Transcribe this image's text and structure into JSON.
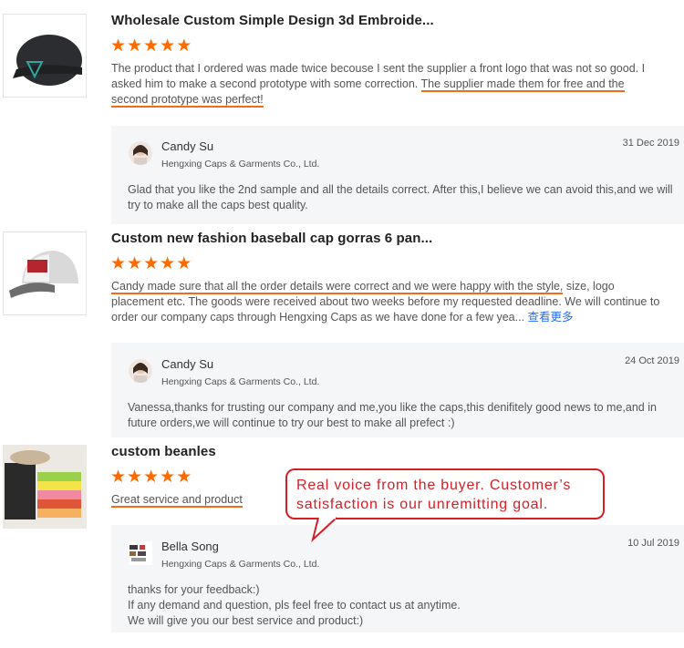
{
  "reviews": [
    {
      "title": "Wholesale Custom Simple Design 3d Embroide...",
      "stars": 5,
      "text_plain": "The product that I ordered was made twice becouse I sent the supplier a front logo that was not so good. I asked him to make a second prototype with some correction. ",
      "text_highlight": "The supplier made them for free and the second prototype was perfect!",
      "reply": {
        "name": "Candy Su",
        "company": "Hengxing Caps & Garments Co., Ltd.",
        "date": "31 Dec 2019",
        "text": "Glad that you like the 2nd sample and all the details correct. After this,I believe we can avoid this,and we will try to make all the caps best quality."
      }
    },
    {
      "title": "Custom new fashion baseball cap gorras 6 pan...",
      "stars": 5,
      "text_highlight": "Candy made sure that all the order details were correct and we were happy with the style,",
      "text_plain": " size, logo placement etc. The goods were received about two weeks before my requested deadline. We will continue to order our company caps through Hengxing Caps as we have done for a few yea...",
      "more_link": "查看更多",
      "reply": {
        "name": "Candy Su",
        "company": "Hengxing Caps & Garments Co., Ltd.",
        "date": "24 Oct 2019",
        "text": "Vanessa,thanks for trusting our company and me,you like the caps,this denifitely good news to me,and in future orders,we will continue to try our best to make all prefect :)"
      }
    },
    {
      "title": "custom beanles",
      "stars": 5,
      "text_highlight": "Great service and product",
      "reply": {
        "name": "Bella Song",
        "company": "Hengxing Caps & Garments Co., Ltd.",
        "date": "10 Jul 2019",
        "text_lines": [
          "thanks for your feedback:)",
          "If any demand and question, pls feel free to contact us at anytime.",
          "We will give you our best service and product:)"
        ]
      }
    }
  ],
  "callout": {
    "text": "Real voice from the buyer. Customer’s satisfaction is our unremitting goal."
  },
  "icons": {
    "star": "star-icon",
    "avatar": "avatar-icon"
  },
  "colors": {
    "star": "#ff6a00",
    "underline": "#f26a1b",
    "callout": "#d51f26",
    "link": "#2a6df4",
    "reply_bg": "#f5f6f7"
  }
}
